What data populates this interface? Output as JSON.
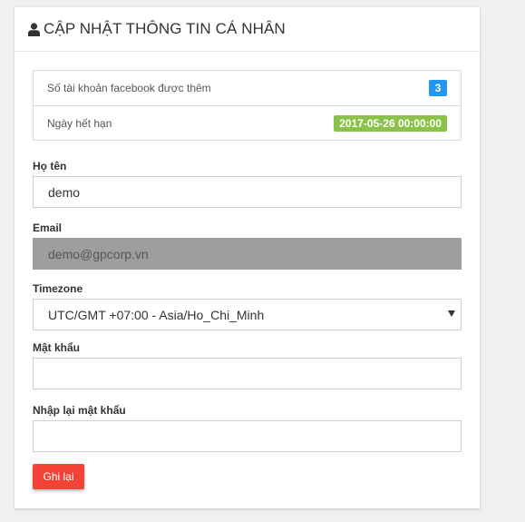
{
  "header": {
    "title": "CẬP NHẬT THÔNG TIN CÁ NHÂN",
    "icon": "user-icon"
  },
  "info": {
    "accounts_label": "Số tài khoản facebook được thêm",
    "accounts_count": "3",
    "expiry_label": "Ngày hết hạn",
    "expiry_value": "2017-05-26 00:00:00"
  },
  "form": {
    "name_label": "Họ tên",
    "name_value": "demo",
    "email_label": "Email",
    "email_value": "demo@gpcorp.vn",
    "timezone_label": "Timezone",
    "timezone_value": "UTC/GMT +07:00 - Asia/Ho_Chi_Minh",
    "password_label": "Mật khẩu",
    "password_value": "",
    "confirm_label": "Nhập lại mật khẩu",
    "confirm_value": "",
    "save_label": "Ghi lại"
  },
  "colors": {
    "accent_blue": "#2196f3",
    "accent_green": "#8bc34a",
    "button_red": "#f44336",
    "disabled_gray": "#9e9e9e"
  }
}
